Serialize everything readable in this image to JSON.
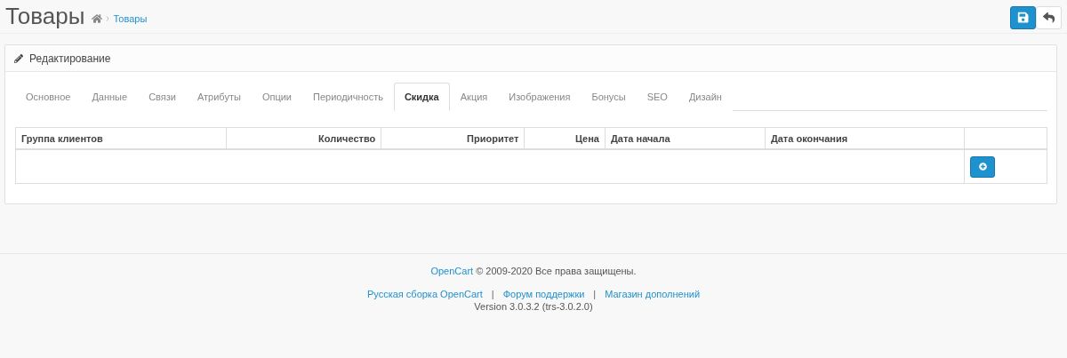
{
  "page_header": {
    "title": "Товары",
    "breadcrumb": [
      {
        "kind": "home"
      },
      {
        "kind": "link",
        "label": "Товары"
      }
    ],
    "buttons": [
      {
        "kind": "save",
        "primary": true
      },
      {
        "kind": "back",
        "primary": false
      }
    ]
  },
  "panel": {
    "title": "Редактирование",
    "tabs": [
      {
        "label": "Основное",
        "selected": false
      },
      {
        "label": "Данные",
        "selected": false
      },
      {
        "label": "Связи",
        "selected": false
      },
      {
        "label": "Атрибуты",
        "selected": false
      },
      {
        "label": "Опции",
        "selected": false
      },
      {
        "label": "Периодичность",
        "selected": false
      },
      {
        "label": "Скидка",
        "selected": true
      },
      {
        "label": "Акция",
        "selected": false
      },
      {
        "label": "Изображения",
        "selected": false
      },
      {
        "label": "Бонусы",
        "selected": false
      },
      {
        "label": "SEO",
        "selected": false
      },
      {
        "label": "Дизайн",
        "selected": false
      }
    ],
    "table": {
      "columns": [
        {
          "label": "Группа клиентов",
          "kind": "text"
        },
        {
          "label": "Количество",
          "kind": "number"
        },
        {
          "label": "Приоритет",
          "kind": "number"
        },
        {
          "label": "Цена",
          "kind": "number"
        },
        {
          "label": "Дата начала",
          "kind": "text"
        },
        {
          "label": "Дата окончания",
          "kind": "text"
        }
      ],
      "add_button": {
        "kind": "add"
      }
    }
  },
  "footer": {
    "copyright": {
      "link": "OpenCart",
      "text": "© 2009-2020 Все права защищены."
    },
    "links": [
      {
        "kind": "link",
        "label": "Русская сборка OpenCart"
      },
      {
        "kind": "separator",
        "label": "|"
      },
      {
        "kind": "link",
        "label": "Форум поддержки"
      },
      {
        "kind": "separator",
        "label": "|"
      },
      {
        "kind": "link",
        "label": "Магазин дополнений"
      }
    ],
    "version": "Version 3.0.3.2 (trs-3.0.2.0)"
  }
}
